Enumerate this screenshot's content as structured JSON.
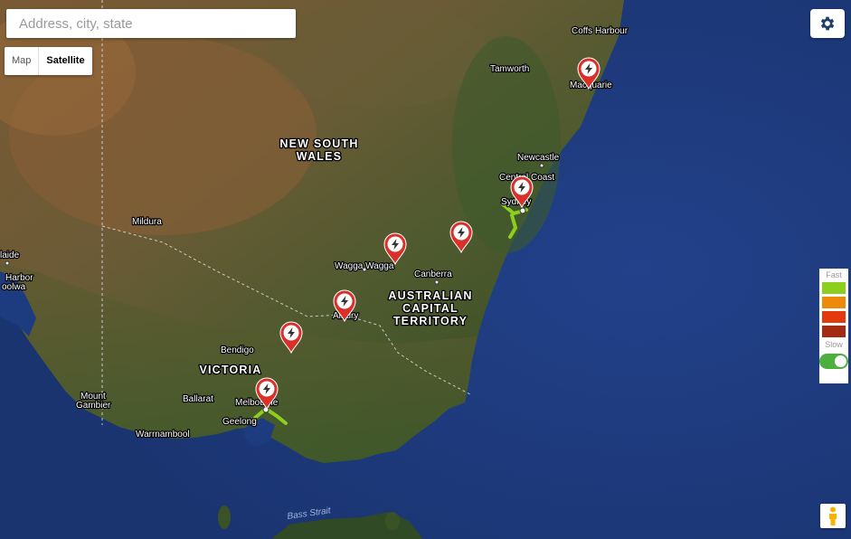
{
  "search": {
    "placeholder": "Address, city, state"
  },
  "map_type": {
    "options": [
      "Map",
      "Satellite"
    ],
    "selected": "Satellite"
  },
  "settings": {
    "icon": "gear-icon"
  },
  "legend": {
    "top_label": "Fast",
    "bottom_label": "Slow",
    "colors": [
      "#8ccf1e",
      "#ee8a0a",
      "#e23a0e",
      "#a52a12"
    ],
    "toggle_on": true
  },
  "map": {
    "regions": [
      "NEW SOUTH",
      "WALES",
      "AUSTRALIAN",
      "CAPITAL",
      "TERRITORY",
      "VICTORIA"
    ],
    "cities": [
      "Coffs Harbour",
      "Tamworth",
      "Macquarie",
      "Newcastle",
      "Central Coast",
      "Sydney",
      "Mildura",
      "Canberra",
      "Wagga Wagga",
      "Albury",
      "Bendigo",
      "Ballarat",
      "Melbourne",
      "Geelong",
      "Mount",
      "Gambier",
      "Warrnambool",
      "laide",
      "Harbor",
      "oolwa"
    ],
    "water_labels": [
      "Bass Strait"
    ],
    "marker_icon": "lightning-bolt-icon",
    "marker_count": 8
  }
}
